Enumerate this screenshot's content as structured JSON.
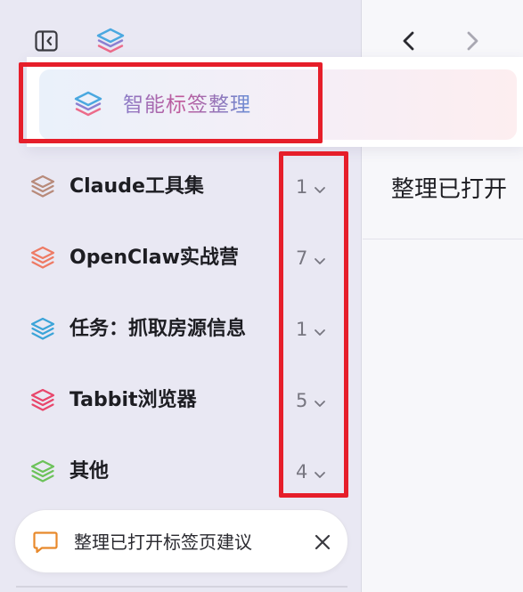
{
  "popup": {
    "label": "智能标签整理",
    "icon": "layers-icon"
  },
  "groups": [
    {
      "label": "Claude工具集",
      "count": "1",
      "icon": "layers-icon",
      "color": "#b88a7a"
    },
    {
      "label": "OpenClaw实战营",
      "count": "7",
      "icon": "layers-icon",
      "color": "#ee7a64"
    },
    {
      "label": "任务：抓取房源信息",
      "count": "1",
      "icon": "layers-icon",
      "color": "#3ba4d8"
    },
    {
      "label": "Tabbit浏览器",
      "count": "5",
      "icon": "layers-icon",
      "color": "#e8466b"
    },
    {
      "label": "其他",
      "count": "4",
      "icon": "layers-icon",
      "color": "#6cc25a"
    }
  ],
  "suggestion": {
    "text": "整理已打开标签页建议",
    "icon": "chat-icon",
    "accent": "#e8892b"
  },
  "main": {
    "title": "整理已打开"
  },
  "colors": {
    "highlight": "#e61e2a",
    "sidebar_bg": "#e9e8f3"
  }
}
